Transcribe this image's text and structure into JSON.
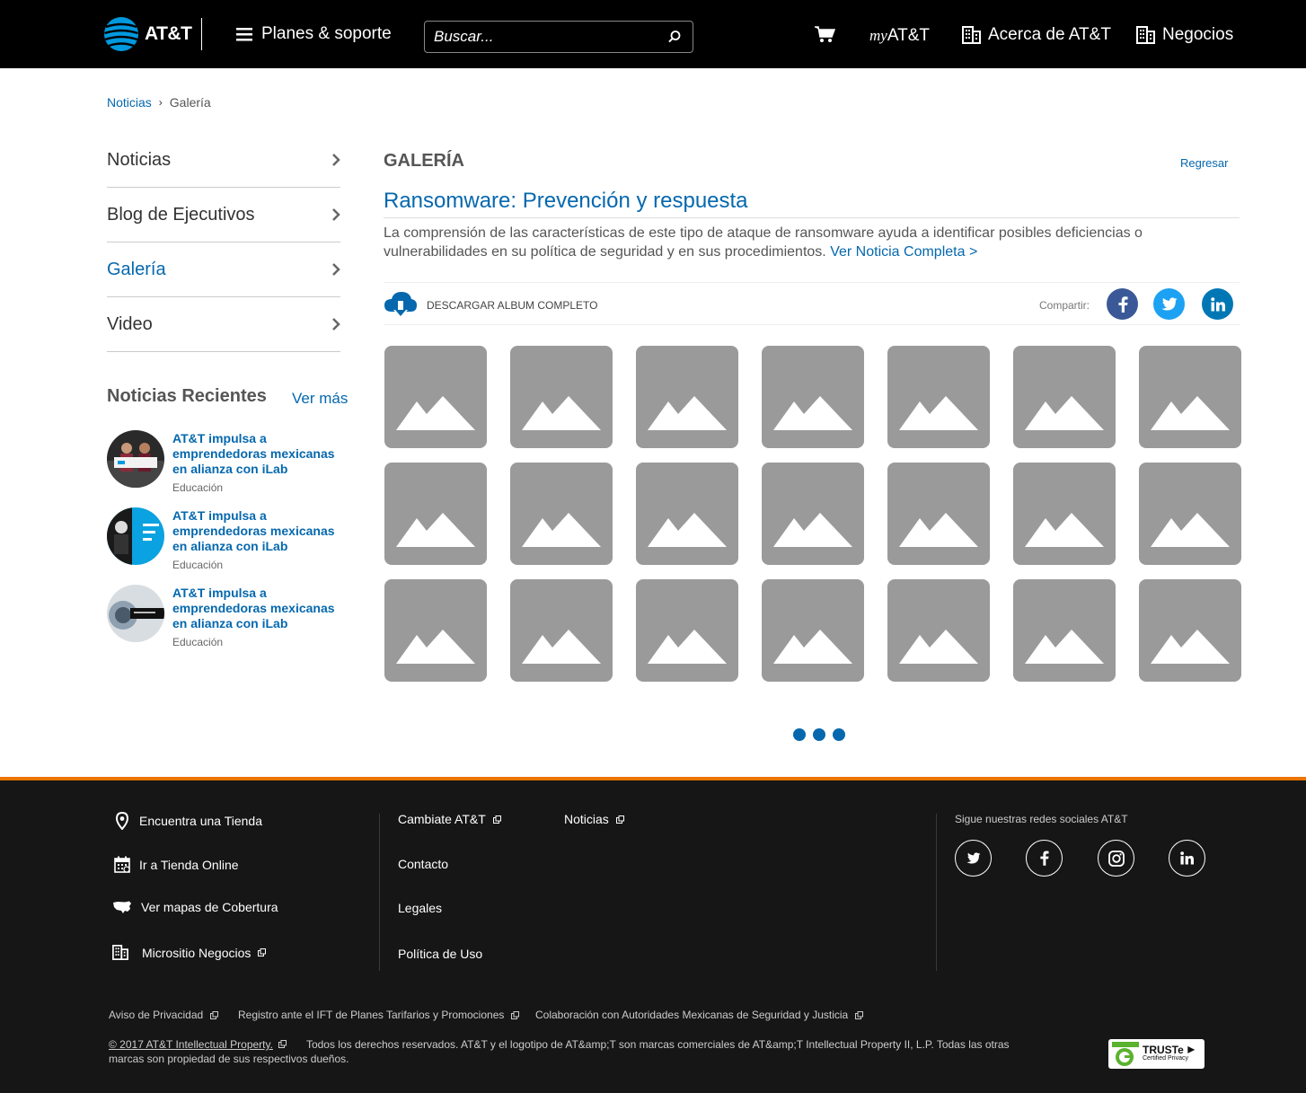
{
  "header": {
    "logo_text": "AT&T",
    "menu_label": "Planes & soporte",
    "search_placeholder": "Buscar...",
    "myatt_prefix": "my",
    "myatt_suffix": "AT&T",
    "about_label": "Acerca de AT&T",
    "business_label": "Negocios"
  },
  "breadcrumb": {
    "parent": "Noticias",
    "current": "Galería"
  },
  "sidebar": {
    "items": [
      {
        "label": "Noticias",
        "active": false
      },
      {
        "label": "Blog de Ejecutivos",
        "active": false
      },
      {
        "label": "Galería",
        "active": true
      },
      {
        "label": "Video",
        "active": false
      }
    ],
    "recent_title": "Noticias Recientes",
    "see_more": "Ver más",
    "recent_news": [
      {
        "title": "AT&T impulsa a emprendedoras mexicanas en alianza con iLab",
        "category": "Educación"
      },
      {
        "title": "AT&T impulsa a emprendedoras mexicanas en alianza con iLab",
        "category": "Educación"
      },
      {
        "title": "AT&T impulsa a emprendedoras mexicanas en alianza con iLab",
        "category": "Educación"
      }
    ]
  },
  "main": {
    "heading": "GALERÍA",
    "back_label": "Regresar",
    "article_title": "Ransomware: Prevención y respuesta",
    "description": "La comprensión de las características de este tipo de ataque de ransomware ayuda a identificar posibles deficiencias o vulnerabilidades en su política de seguridad y en sus procedimientos.",
    "read_more": "Ver Noticia Completa >",
    "download_label": "DESCARGAR ALBUM COMPLETO",
    "share_label": "Compartir:",
    "tile_count": 21,
    "page_count": 3
  },
  "footer": {
    "left_links": [
      "Encuentra una Tienda",
      "Ir a Tienda Online",
      "Ver mapas de Cobertura",
      "Micrositio Negocios"
    ],
    "mid_links": [
      "Cambiate AT&T",
      "Contacto",
      "Legales",
      "Política de Uso"
    ],
    "news_link": "Noticias",
    "follow_label": "Sigue nuestras redes sociales AT&T",
    "legal_links": [
      "Aviso de Privacidad",
      "Registro ante el IFT de Planes Tarifarios y Promociones",
      "Colaboración con Autoridades Mexicanas de Seguridad y Justicia"
    ],
    "copyright_link": "© 2017 AT&T Intellectual Property.",
    "copyright_text": "Todos los derechos reservados. AT&T y el logotipo de AT&amp;T son marcas comerciales de AT&amp;T Intellectual Property II, L.P. Todas las otras marcas son propiedad de sus respectivos dueños.",
    "truste_title": "TRUSTe",
    "truste_sub": "Certified Privacy"
  },
  "colors": {
    "brand_blue": "#0568ae",
    "accent_orange": "#ea7400",
    "facebook": "#3b5998",
    "twitter": "#1da1f2",
    "linkedin": "#0077b5"
  }
}
